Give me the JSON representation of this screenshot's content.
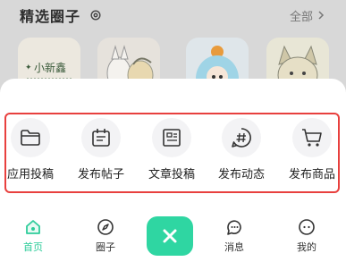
{
  "background": {
    "section_title": "精选圈子",
    "all_link": "全部",
    "card1_text": "小新鑫"
  },
  "actions": [
    {
      "label": "应用投稿",
      "icon": "folder-icon"
    },
    {
      "label": "发布帖子",
      "icon": "calendar-icon"
    },
    {
      "label": "文章投稿",
      "icon": "article-icon"
    },
    {
      "label": "发布动态",
      "icon": "hashtag-icon"
    },
    {
      "label": "发布商品",
      "icon": "cart-icon"
    }
  ],
  "nav": {
    "home": "首页",
    "circle": "圈子",
    "messages": "消息",
    "mine": "我的"
  },
  "colors": {
    "accent": "#2fd6a2",
    "highlight": "#e8403e"
  }
}
